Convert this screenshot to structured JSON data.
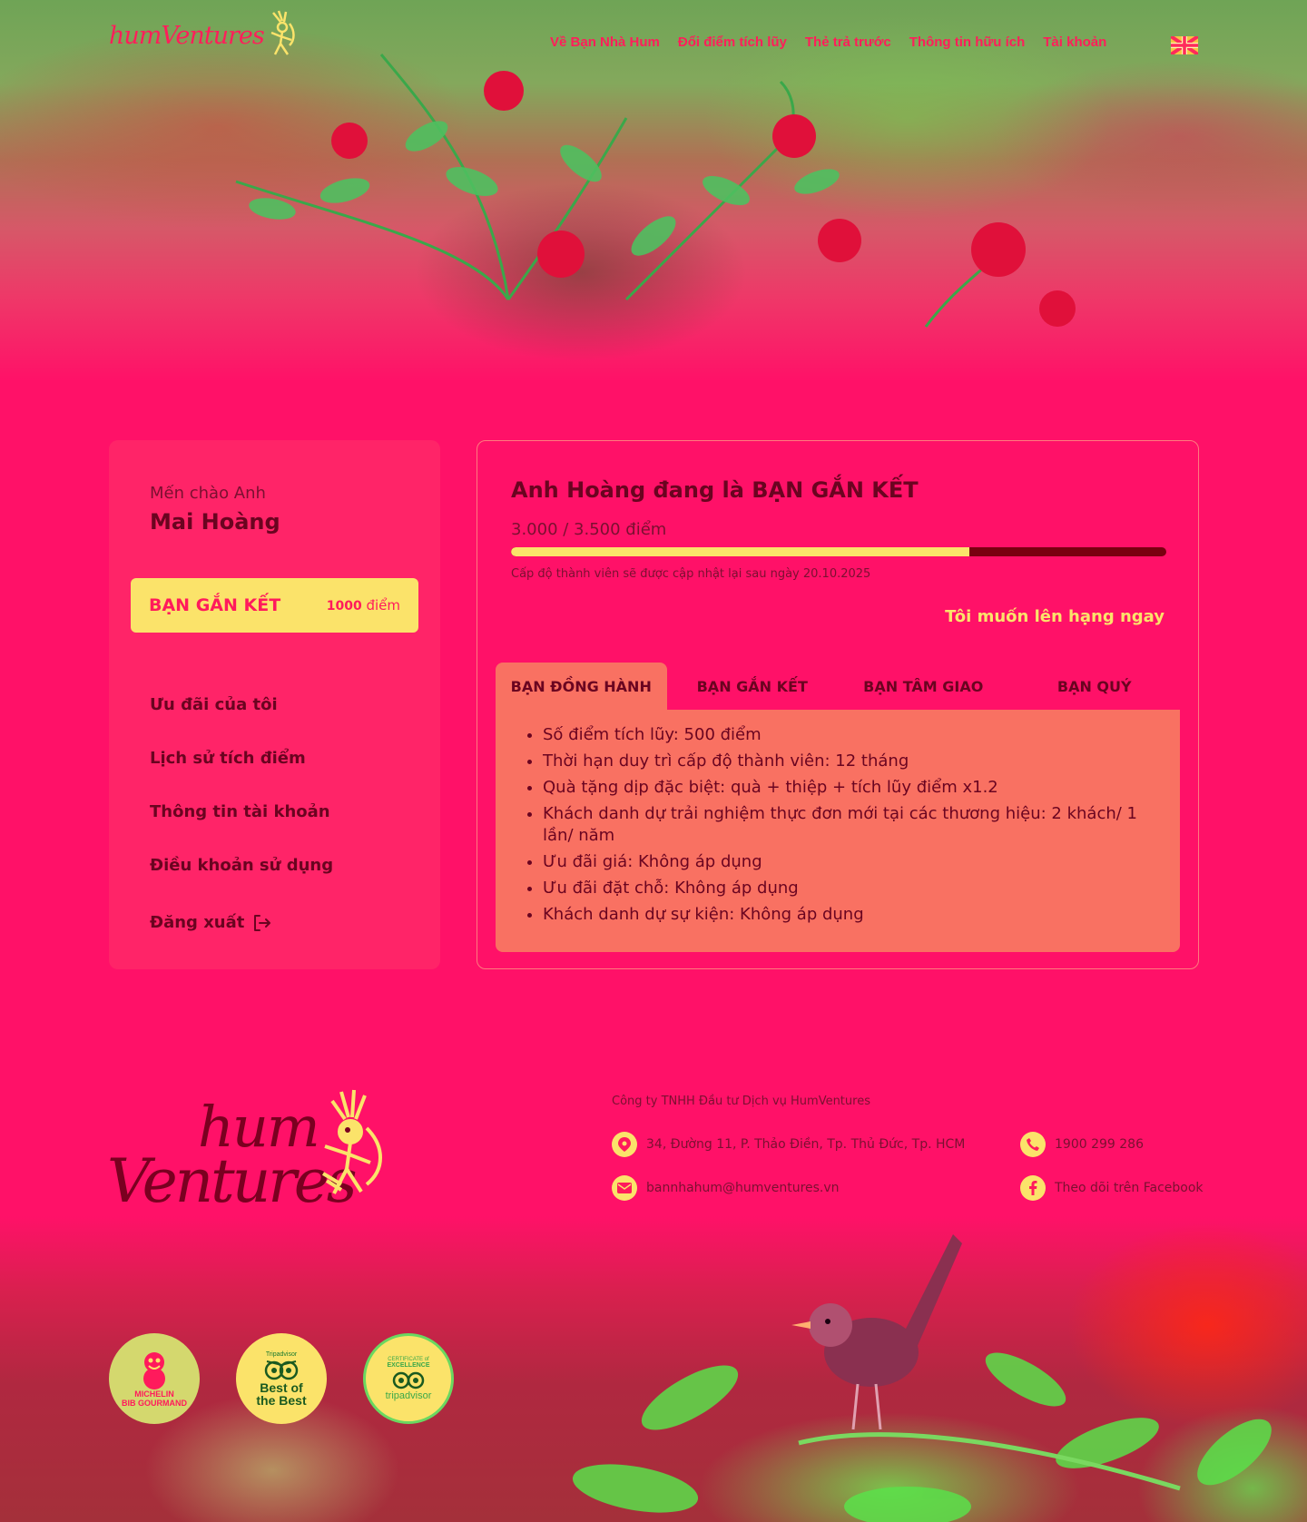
{
  "header": {
    "logo_text": "humVentures",
    "nav": [
      "Về Bạn Nhà Hum",
      "Đổi điểm tích lũy",
      "Thẻ trả trước",
      "Thông tin hữu ích",
      "Tài khoản"
    ]
  },
  "sidebar": {
    "greeting": "Mến chào Anh",
    "name": "Mai Hoàng",
    "tier_name": "BẠN GẮN KẾT",
    "tier_points": "1000",
    "tier_points_unit": "điểm",
    "menu": [
      "Ưu đãi của tôi",
      "Lịch sử tích điểm",
      "Thông tin tài khoản",
      "Điều khoản sử dụng"
    ],
    "logout": "Đăng xuất"
  },
  "main": {
    "title": "Anh Hoàng đang là BẠN GẮN KẾT",
    "progress_text": "3.000 / 3.500 điểm",
    "progress_fraction": 0.7,
    "update_note": "Cấp độ thành viên sẽ được cập nhật lại sau ngày 20.10.2025",
    "upgrade_link": "Tôi muốn lên hạng ngay",
    "tabs": [
      "BẠN ĐỒNG HÀNH",
      "BẠN GẮN KẾT",
      "BẠN TÂM GIAO",
      "BẠN QUÝ"
    ],
    "active_tab": 0,
    "benefits": [
      "Số điểm tích lũy: 500 điểm",
      "Thời hạn duy trì cấp độ thành viên: 12 tháng",
      "Quà tặng dịp đặc biệt: quà + thiệp + tích lũy điểm x1.2",
      "Khách danh dự trải nghiệm thực đơn mới tại các thương hiệu: 2 khách/ 1 lần/ năm",
      "Ưu đãi giá: Không áp dụng",
      "Ưu đãi đặt chỗ: Không áp dụng",
      "Khách danh dự sự kiện: Không áp dụng"
    ]
  },
  "footer": {
    "logo_hum": "hum",
    "logo_ventures": "Ventures",
    "company": "Công ty TNHH Đầu tư Dịch vụ HumVentures",
    "address": "34, Đường 11, P. Thảo Điền,  Tp. Thủ Đức, Tp. HCM",
    "phone": "1900 299 286",
    "email": "bannhahum@humventures.vn",
    "facebook": "Theo dõi trên Facebook",
    "badges": {
      "michelin_line1": "MICHELIN",
      "michelin_line2": "BIB GOURMAND",
      "tripadvisor_small": "Tripadvisor",
      "best_line1": "Best of",
      "best_line2": "the Best",
      "cert_line1": "CERTIFICATE of",
      "cert_line2": "EXCELLENCE",
      "cert_brand": "tripadvisor"
    }
  },
  "colors": {
    "background": "#ff1168",
    "accent_yellow": "#fbe36a",
    "tab_panel": "#f97162",
    "text_dark": "#6a0420"
  }
}
